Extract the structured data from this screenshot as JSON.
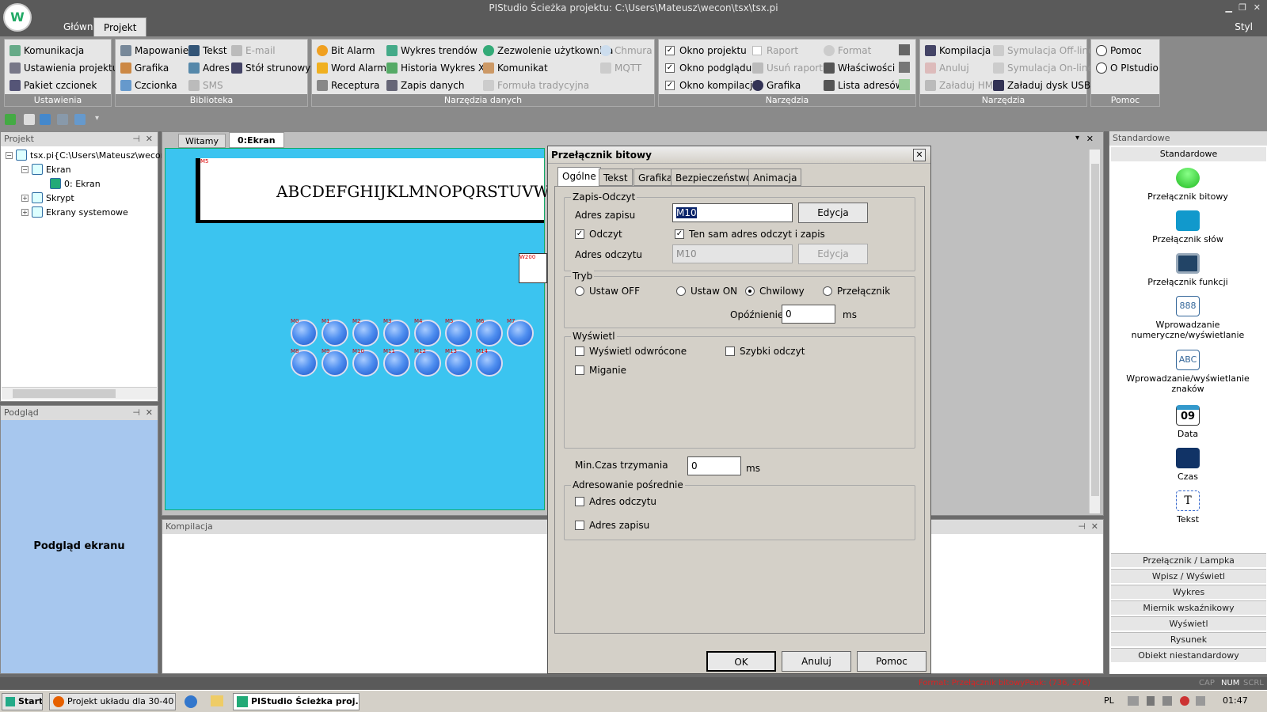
{
  "window": {
    "title": "PIStudio Ścieżka projektu: C:\\Users\\Mateusz\\wecon\\tsx\\tsx.pi",
    "style_label": "Styl"
  },
  "ribbon_tabs": [
    "Główne",
    "Projekt"
  ],
  "ribbon": {
    "ustawienia": {
      "caption": "Ustawienia",
      "items": [
        "Komunikacja",
        "Ustawienia projektu",
        "Pakiet czcionek"
      ]
    },
    "biblioteka": {
      "caption": "Biblioteka",
      "items": [
        "Mapowanie",
        "Grafika",
        "Czcionka",
        "Tekst",
        "Adres",
        "SMS",
        "E-mail",
        "Stół strunowy"
      ]
    },
    "narzedzia_danych": {
      "caption": "Narzędzia danych",
      "items": [
        "Bit Alarm",
        "Word Alarm",
        "Receptura",
        "Wykres trendów",
        "Historia Wykres XY",
        "Zapis danych",
        "Zezwolenie użytkownika",
        "Komunikat",
        "Formuła tradycyjna",
        "Chmura",
        "MQTT"
      ]
    },
    "narzedzia": {
      "caption": "Narzędzia",
      "items": [
        "Okno projektu",
        "Okno podglądu",
        "Okno kompilacji",
        "Raport",
        "Usuń raport",
        "Grafika",
        "Format",
        "Właściwości",
        "Lista adresów"
      ]
    },
    "narzedzia2": {
      "caption": "Narzędzia",
      "items": [
        "Kompilacja",
        "Anuluj",
        "Załaduj HMI",
        "Symulacja Off-line",
        "Symulacja On-line",
        "Załaduj dysk USB"
      ]
    },
    "pomoc": {
      "caption": "Pomoc",
      "items": [
        "Pomoc",
        "O PIstudio"
      ]
    }
  },
  "project_panel": {
    "title": "Projekt",
    "tree": [
      "tsx.pi{C:\\Users\\Mateusz\\wecon\\",
      "Ekran",
      "0: Ekran",
      "Skrypt",
      "Ekrany systemowe"
    ]
  },
  "preview_panel": {
    "title": "Podgląd",
    "body": "Podgląd ekranu"
  },
  "doc_tabs": [
    "Witamy",
    "0:Ekran"
  ],
  "canvas": {
    "text_box": "ABCDEFGHIJKLMNOPQRSTUVWXYZ",
    "text_box_tag": "M5",
    "word_tag": "W200",
    "lamps_row1": [
      "M0",
      "M1",
      "M2",
      "M3",
      "M4",
      "M5",
      "M6",
      "M7"
    ],
    "lamps_row2": [
      "M8",
      "M9",
      "M10",
      "M11",
      "M12",
      "M13",
      "M14"
    ]
  },
  "compile_panel": {
    "title": "Kompilacja"
  },
  "dialog": {
    "title": "Przełącznik bitowy",
    "tabs": [
      "Ogólne",
      "Tekst",
      "Grafika",
      "Bezpieczeństwo",
      "Animacja"
    ],
    "rw": {
      "legend": "Zapis-Odczyt",
      "write_label": "Adres zapisu",
      "write_value": "M10",
      "edit": "Edycja",
      "read_chk": "Odczyt",
      "same_chk": "Ten sam adres odczyt i zapis",
      "read_label": "Adres odczytu",
      "read_value": "M10",
      "edit2": "Edycja"
    },
    "mode": {
      "legend": "Tryb",
      "off": "Ustaw OFF",
      "on": "Ustaw ON",
      "momentary": "Chwilowy",
      "toggle": "Przełącznik",
      "delay_label": "Opóźnienie:",
      "delay_value": "0",
      "delay_unit": "ms"
    },
    "display": {
      "legend": "Wyświetl",
      "inverted": "Wyświetl odwrócone",
      "fast": "Szybki odczyt",
      "blink": "Miganie"
    },
    "hold": {
      "label": "Min.Czas trzymania",
      "value": "0",
      "unit": "ms"
    },
    "indirect": {
      "legend": "Adresowanie pośrednie",
      "read": "Adres odczytu",
      "write": "Adres zapisu"
    },
    "buttons": {
      "ok": "OK",
      "cancel": "Anuluj",
      "help": "Pomoc"
    }
  },
  "toolbox": {
    "title": "Standardowe",
    "header": "Standardowe",
    "tools": [
      "Przełącznik bitowy",
      "Przełącznik słów",
      "Przełącznik funkcji",
      "Wprowadzanie numeryczne/wyświetlanie",
      "Wprowadzanie/wyświetlanie znaków",
      "Data",
      "Czas",
      "Tekst"
    ],
    "categories": [
      "Przełącznik / Lampka",
      "Wpisz / Wyświetl",
      "Wykres",
      "Miernik wskaźnikowy",
      "Wyświetl",
      "Rysunek",
      "Obiekt niestandardowy"
    ],
    "data_icon": "09"
  },
  "statusbar": {
    "format": "Format: Przełącznik bitowyPeak: (736, 276)",
    "cap": "CAP",
    "num": "NUM",
    "scrl": "SCRL"
  },
  "taskbar": {
    "start": "Start",
    "items": [
      "Projekt układu dla 30-40 ...",
      "PIStudio Ścieżka proj..."
    ],
    "lang": "PL",
    "clock": "01:47"
  }
}
